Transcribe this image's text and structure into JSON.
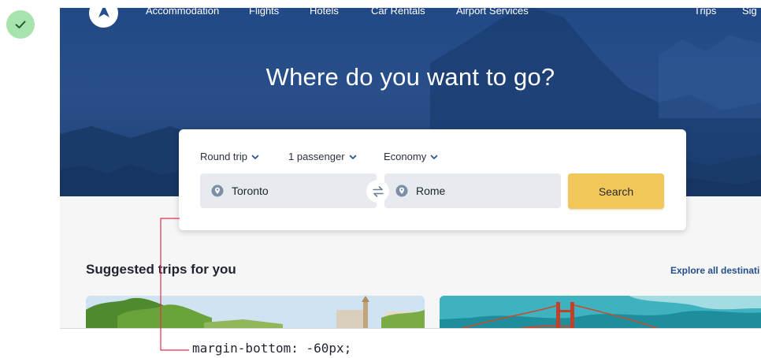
{
  "status": {
    "icon": "checkmark-icon",
    "color": "#a7e3ad"
  },
  "nav": {
    "logo": "brand-logo-icon",
    "links": [
      "Accommodation",
      "Flights",
      "Hotels",
      "Car Rentals",
      "Airport Services"
    ],
    "right_links": [
      "Trips",
      "Sig"
    ]
  },
  "hero": {
    "title": "Where do you want to go?"
  },
  "search": {
    "trip_type": "Round trip",
    "passengers": "1 passenger",
    "cabin_class": "Economy",
    "origin": "Toronto",
    "destination": "Rome",
    "button_label": "Search"
  },
  "suggested": {
    "title": "Suggested trips for you",
    "explore_label": "Explore all destinati"
  },
  "annotation": {
    "text": "margin-bottom: -60px;",
    "color": "#e0334a"
  },
  "colors": {
    "brand": "#234f8c",
    "accent": "#f1c75a",
    "hero_bg": "#284f8a"
  }
}
